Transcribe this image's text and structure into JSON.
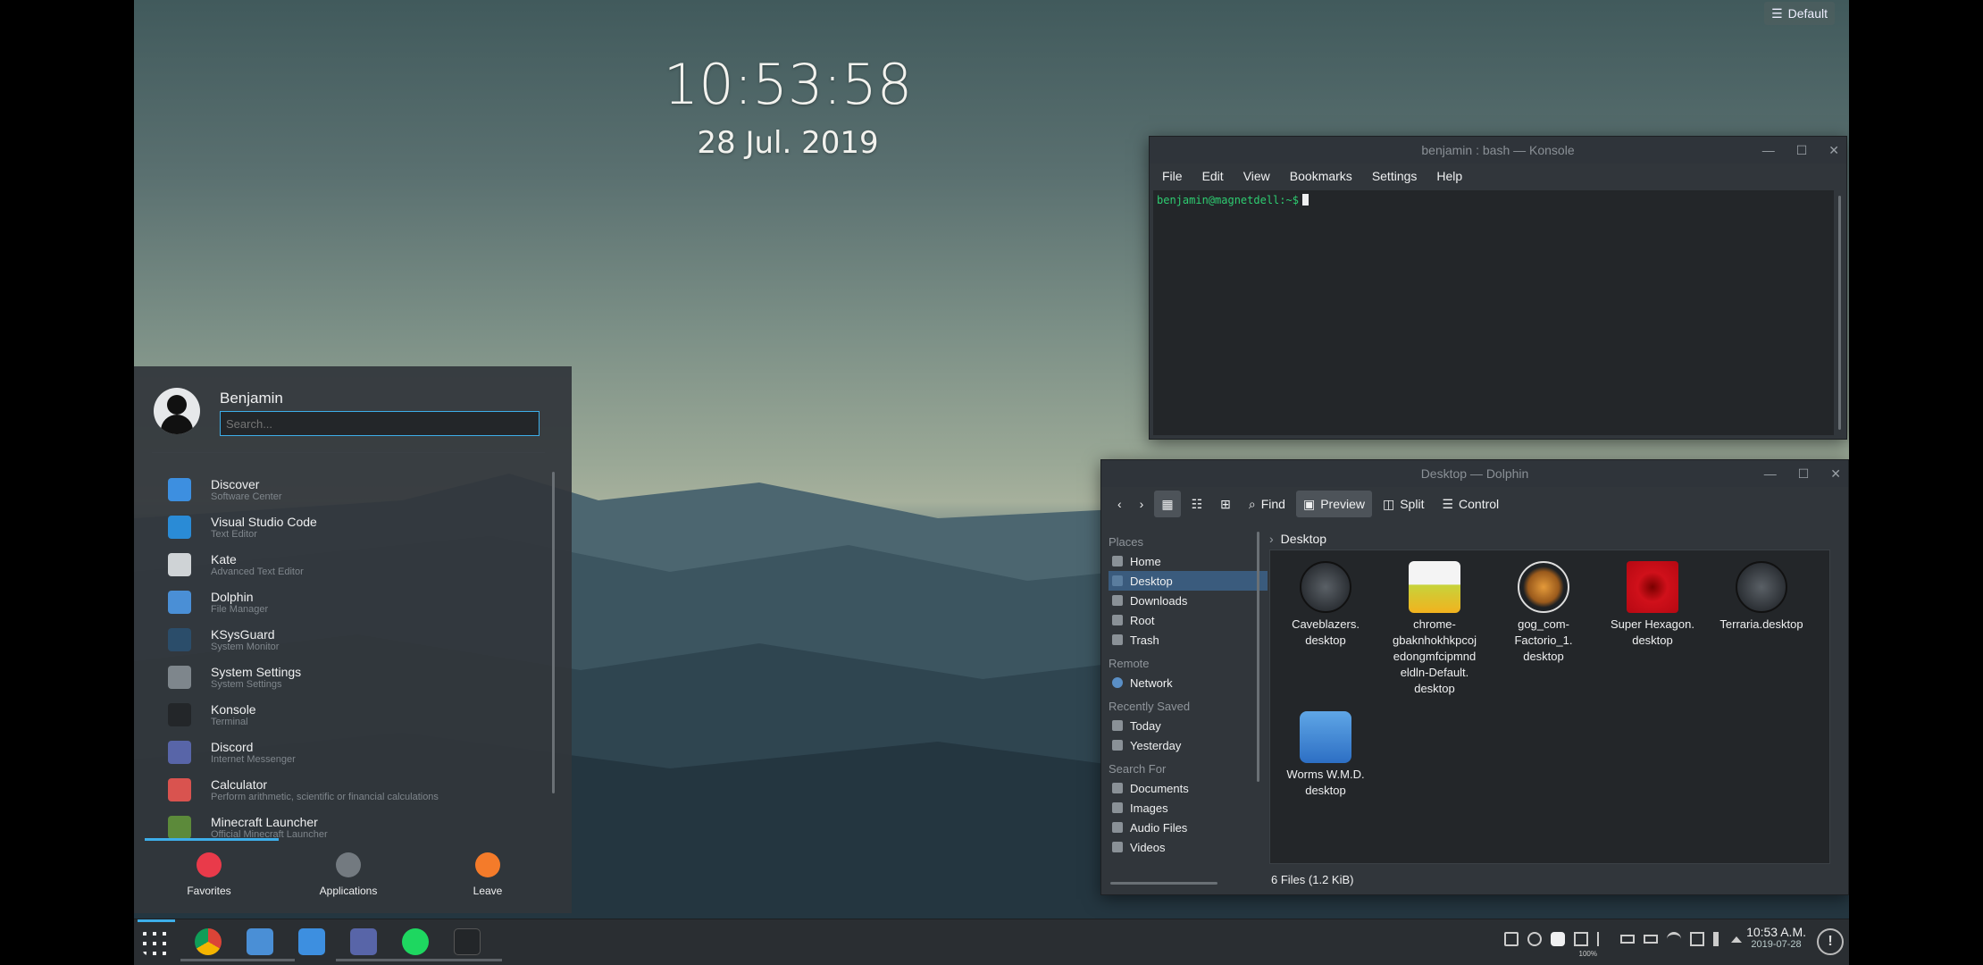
{
  "desktop": {
    "clock_time": "10:53:58",
    "clock_date": "28 Jul. 2019",
    "default_label": "Default"
  },
  "konsole": {
    "title": "benjamin : bash — Konsole",
    "menu": [
      "File",
      "Edit",
      "View",
      "Bookmarks",
      "Settings",
      "Help"
    ],
    "prompt": "benjamin@magnetdell:~$"
  },
  "dolphin": {
    "title": "Desktop — Dolphin",
    "toolbar": {
      "find": "Find",
      "preview": "Preview",
      "split": "Split",
      "control": "Control"
    },
    "breadcrumb": "Desktop",
    "places_header": "Places",
    "places": [
      "Home",
      "Desktop",
      "Downloads",
      "Root",
      "Trash"
    ],
    "remote_header": "Remote",
    "remote": [
      "Network"
    ],
    "recent_header": "Recently Saved",
    "recent": [
      "Today",
      "Yesterday"
    ],
    "search_header": "Search For",
    "search": [
      "Documents",
      "Images",
      "Audio Files",
      "Videos"
    ],
    "files": [
      {
        "name": "Caveblazers.\ndesktop",
        "icon": "steam-icon"
      },
      {
        "name": "chrome-\ngbaknhokhkpcoj\nedongmfcipmnd\neldln-Default.\ndesktop",
        "icon": "beta-flask-icon"
      },
      {
        "name": "gog_com-\nFactorio_1.\ndesktop",
        "icon": "factorio-gear-icon"
      },
      {
        "name": "Super Hexagon.\ndesktop",
        "icon": "super-hexagon-icon"
      },
      {
        "name": "Terraria.desktop",
        "icon": "steam-icon"
      },
      {
        "name": "Worms W.M.D.\ndesktop",
        "icon": "worms-icon"
      }
    ],
    "status": "6 Files (1.2 KiB)"
  },
  "startmenu": {
    "user": "Benjamin",
    "search_placeholder": "Search...",
    "apps": [
      {
        "name": "Discover",
        "desc": "Software Center",
        "color": "#3d8fe0"
      },
      {
        "name": "Visual Studio Code",
        "desc": "Text Editor",
        "color": "#2a8bd6"
      },
      {
        "name": "Kate",
        "desc": "Advanced Text Editor",
        "color": "#cfd3d6"
      },
      {
        "name": "Dolphin",
        "desc": "File Manager",
        "color": "#4a8fd6"
      },
      {
        "name": "KSysGuard",
        "desc": "System Monitor",
        "color": "#2b4d6a"
      },
      {
        "name": "System Settings",
        "desc": "System Settings",
        "color": "#7e868c"
      },
      {
        "name": "Konsole",
        "desc": "Terminal",
        "color": "#232629"
      },
      {
        "name": "Discord",
        "desc": "Internet Messenger",
        "color": "#5865a8"
      },
      {
        "name": "Calculator",
        "desc": "Perform arithmetic, scientific or financial calculations",
        "color": "#d9534f"
      },
      {
        "name": "Minecraft Launcher",
        "desc": "Official Minecraft Launcher",
        "color": "#5c8a3a"
      }
    ],
    "tabs": {
      "favorites": "Favorites",
      "applications": "Applications",
      "leave": "Leave"
    }
  },
  "taskbar": {
    "time": "10:53 A.M.",
    "date": "2019-07-28",
    "battery": "100%"
  }
}
